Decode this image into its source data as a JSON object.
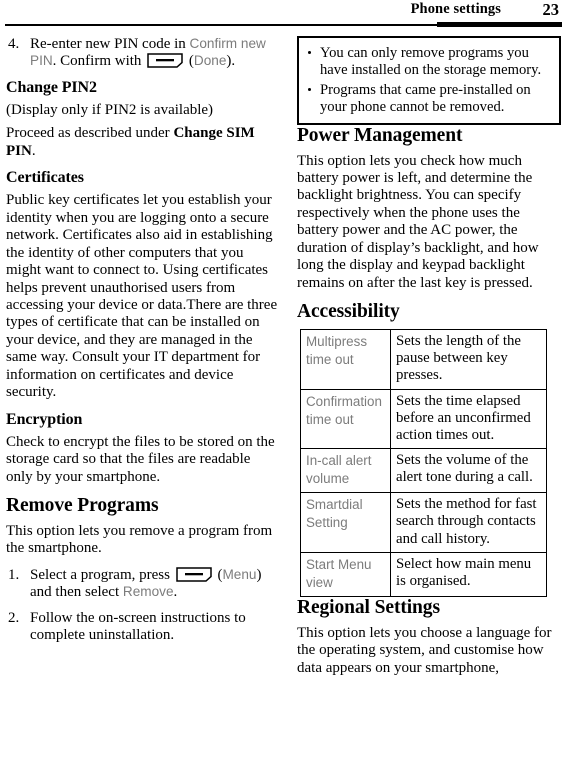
{
  "header": {
    "title": "Phone settings",
    "page_number": "23"
  },
  "left_column": {
    "step4": {
      "number": "4.",
      "text_before_ui": "Re-enter new PIN code in ",
      "ui_label_1": "Confirm new PIN",
      "text_middle": ". Confirm with ",
      "softkey_icon": "softkey-icon",
      "text_after_icon": " (",
      "ui_label_2": "Done",
      "text_end": ")."
    },
    "change_pin2": {
      "heading": "Change PIN2",
      "paragraph_1": "(Display only if PIN2 is available)",
      "paragraph_2_before": "Proceed as described under ",
      "paragraph_2_bold": "Change SIM PIN",
      "paragraph_2_after": "."
    },
    "certificates": {
      "heading": "Certificates",
      "paragraph": "Public key certificates let you establish your identity when you are logging onto a secure network. Certificates also aid in establishing the identity of other computers that you might want to connect to. Using certificates helps prevent unauthorised users from accessing your device or data.There are three types of certificate that can be installed on your device, and they are managed in the same way. Consult your IT department for information on certificates and device security."
    },
    "encryption": {
      "heading": "Encryption",
      "paragraph": "Check to encrypt the files to be stored on the storage card so that the files are readable only by your smartphone."
    },
    "remove_programs": {
      "heading": "Remove Programs",
      "paragraph": "This option lets you remove a program from the smartphone.",
      "step1": {
        "number": "1.",
        "text_before_icon": "Select a program, press ",
        "softkey_icon": "softkey-icon",
        "text_after_icon": " (",
        "ui_label_1": "Menu",
        "text_middle": ") and then select ",
        "ui_label_2": "Remove",
        "text_end": "."
      },
      "step2": {
        "number": "2.",
        "text": "Follow the on-screen instructions to complete uninstallation."
      }
    }
  },
  "right_column": {
    "callout": {
      "bullets": [
        "You can only remove programs you have installed on the storage memory.",
        "Programs that came pre-installed on your phone cannot be removed."
      ]
    },
    "power_management": {
      "heading": "Power Management",
      "paragraph": "This option lets you check how much battery power is left, and determine the backlight brightness. You can specify respectively when the phone uses the battery power and the AC power, the duration of display’s backlight, and how long the display and keypad backlight remains on after the last key is pressed."
    },
    "accessibility": {
      "heading": "Accessibility",
      "table_rows": [
        {
          "setting": "Multipress time out",
          "description": "Sets the length of the pause between key presses."
        },
        {
          "setting": "Confirmation time out",
          "description": "Sets the time elapsed before an unconfirmed action times out."
        },
        {
          "setting": "In-call alert volume",
          "description": "Sets the volume of the alert tone during a call."
        },
        {
          "setting": "Smartdial Setting",
          "description": "Sets the method for fast search through contacts and call history."
        },
        {
          "setting": "Start Menu view",
          "description": "Select how main menu is organised."
        }
      ]
    },
    "regional_settings": {
      "heading": "Regional Settings",
      "paragraph": "This option lets you choose a language for the operating system, and customise how data appears on your smartphone,"
    }
  },
  "colors": {
    "ui_label_gray": "#7c7c7c",
    "text_black": "#000000",
    "page_background": "#ffffff"
  }
}
